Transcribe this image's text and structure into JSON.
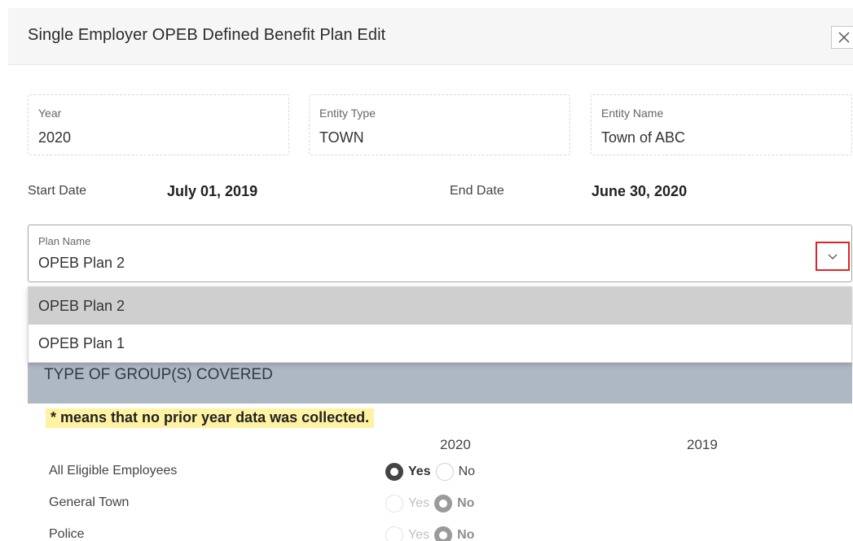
{
  "modal": {
    "title": "Single Employer OPEB Defined Benefit Plan Edit",
    "close_icon": "close-icon"
  },
  "fields": {
    "year": {
      "label": "Year",
      "value": "2020"
    },
    "entity_type": {
      "label": "Entity Type",
      "value": "TOWN"
    },
    "entity_name": {
      "label": "Entity Name",
      "value": "Town of ABC"
    }
  },
  "dates": {
    "start_label": "Start Date",
    "start_value": "July 01, 2019",
    "end_label": "End Date",
    "end_value": "June 30, 2020"
  },
  "plan_select": {
    "label": "Plan Name",
    "value": "OPEB Plan 2",
    "icon": "chevron-down-icon",
    "options": [
      {
        "label": "OPEB Plan 2",
        "selected": true
      },
      {
        "label": "OPEB Plan 1",
        "selected": false
      }
    ]
  },
  "section": {
    "title": "TYPE OF GROUP(S) COVERED",
    "notice": "* means that no prior year data was collected.",
    "columns": [
      "2020",
      "2019"
    ],
    "rows": [
      {
        "label": "All Eligible Employees",
        "yes": "Yes",
        "no": "No",
        "selected": "yes",
        "enabled": true
      },
      {
        "label": "General Town",
        "yes": "Yes",
        "no": "No",
        "selected": "no",
        "enabled": false
      },
      {
        "label": "Police",
        "yes": "Yes",
        "no": "No",
        "selected": "no",
        "enabled": false
      }
    ]
  },
  "colors": {
    "section_bg": "#adb8c2",
    "notice_bg": "#fff3a3",
    "highlight_border": "#e02424",
    "selected_option_bg": "#cfcfcf"
  }
}
